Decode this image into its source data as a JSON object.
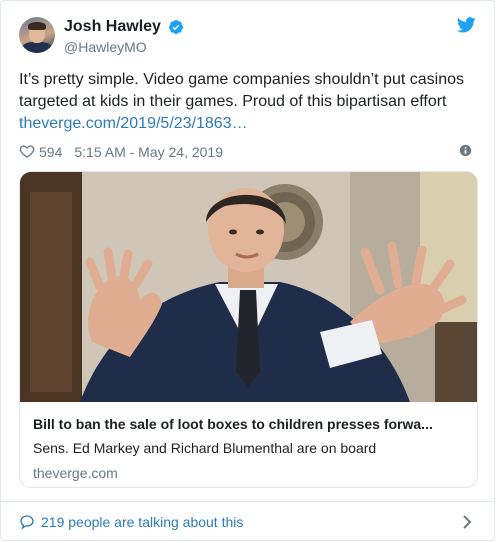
{
  "user": {
    "display_name": "Josh Hawley",
    "handle": "@HawleyMO",
    "verified": true
  },
  "tweet": {
    "text": "It’s pretty simple. Video game companies shouldn’t put casinos targeted at kids in their games. Proud of this bipartisan effort ",
    "link_text": "theverge.com/2019/5/23/1863…",
    "likes": "594",
    "timestamp": "5:15 AM - May 24, 2019"
  },
  "card": {
    "title": "Bill to ban the sale of loot boxes to children presses forwa...",
    "description": "Sens. Ed Markey and Richard Blumenthal are on board",
    "domain": "theverge.com"
  },
  "footer": {
    "talk_text": "219 people are talking about this"
  },
  "icons": {
    "verified": "verified-badge-icon",
    "brand": "twitter-bird-icon",
    "like": "heart-icon",
    "info": "info-icon",
    "conversation": "speech-bubble-icon",
    "more": "chevron-right-icon"
  },
  "colors": {
    "link": "#2b7bb9",
    "twitter_blue": "#1da1f2",
    "secondary_text": "#697882",
    "border": "#e1e8ed"
  }
}
